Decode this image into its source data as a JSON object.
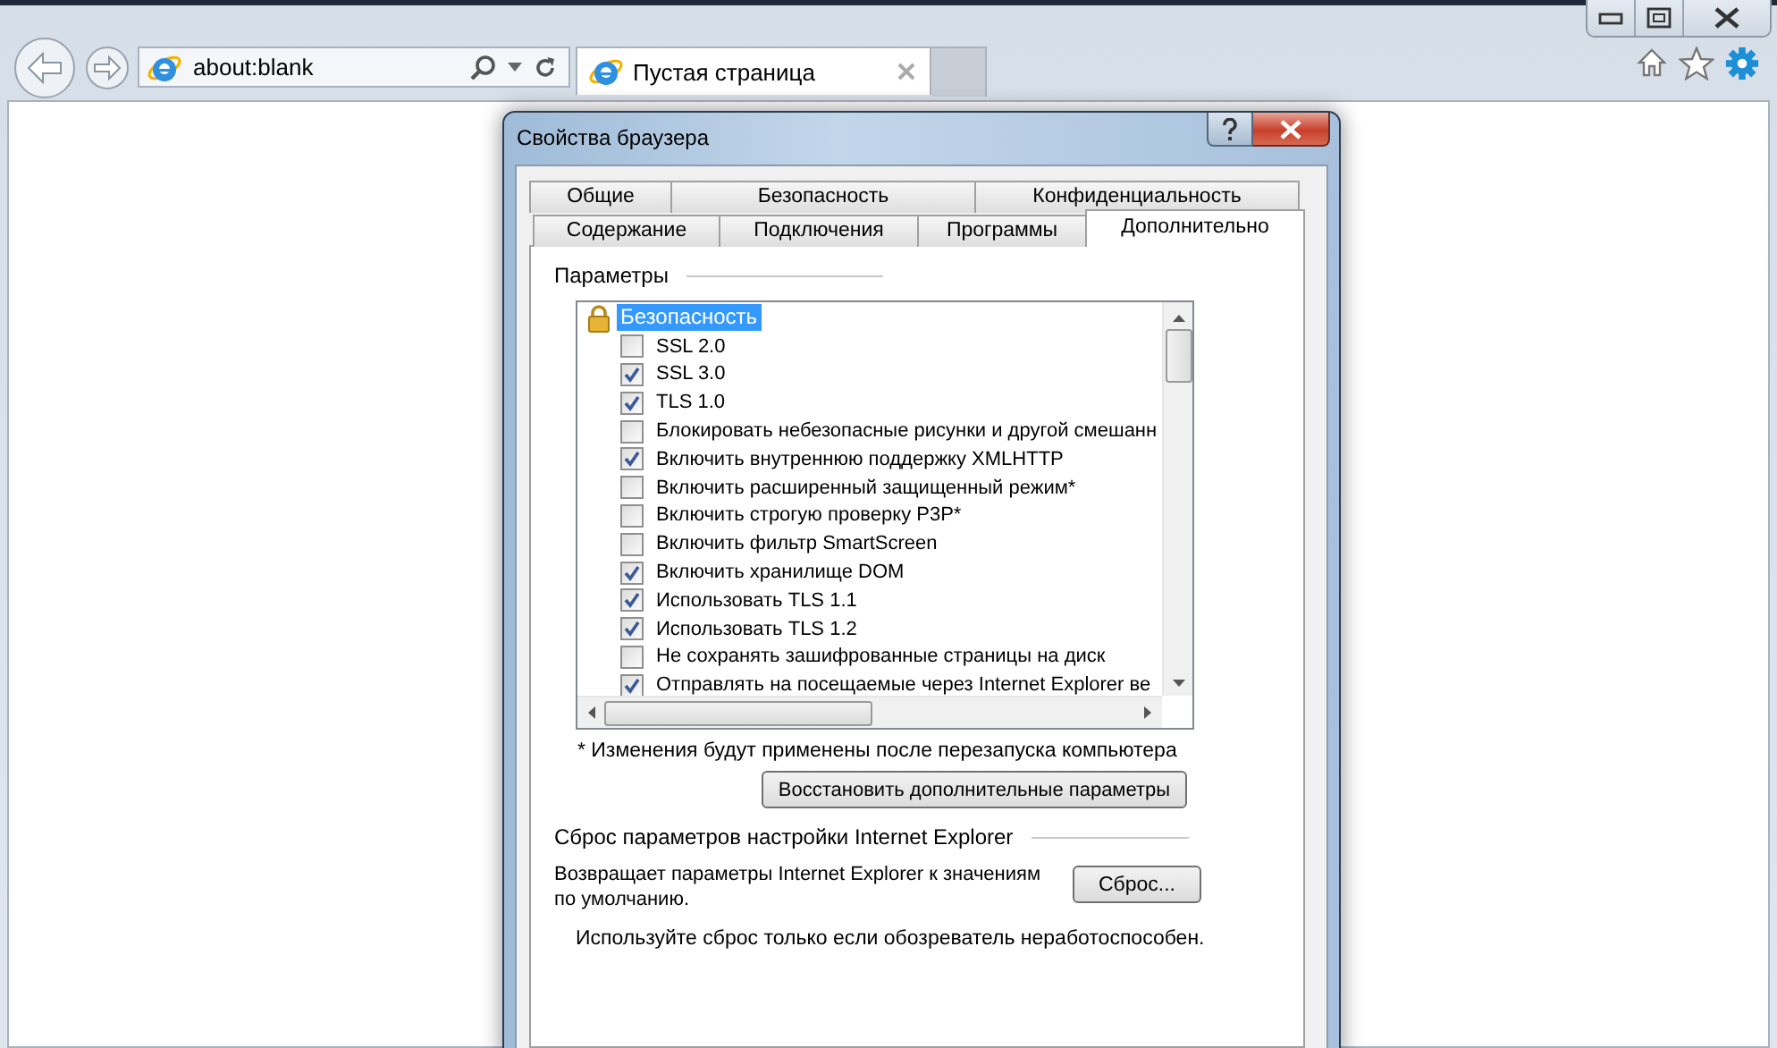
{
  "browser": {
    "address": "about:blank",
    "tab_title": "Пустая страница"
  },
  "dialog": {
    "title": "Свойства браузера",
    "tab_rows": [
      [
        {
          "label": "Общие",
          "selected": false
        },
        {
          "label": "Безопасность",
          "selected": false
        },
        {
          "label": "Конфиденциальность",
          "selected": false
        }
      ],
      [
        {
          "label": "Содержание",
          "selected": false
        },
        {
          "label": "Подключения",
          "selected": false
        },
        {
          "label": "Программы",
          "selected": false
        },
        {
          "label": "Дополнительно",
          "selected": true
        }
      ]
    ],
    "settings_label": "Параметры",
    "tree": {
      "label": "Безопасность",
      "selected": true,
      "children": [
        {
          "label": "SSL 2.0",
          "checked": false
        },
        {
          "label": "SSL 3.0",
          "checked": true
        },
        {
          "label": "TLS 1.0",
          "checked": true
        },
        {
          "label": "Блокировать небезопасные рисунки и другой смешанн",
          "checked": false
        },
        {
          "label": "Включить внутреннюю поддержку XMLHTTP",
          "checked": true
        },
        {
          "label": "Включить расширенный защищенный режим*",
          "checked": false
        },
        {
          "label": "Включить строгую проверку P3P*",
          "checked": false
        },
        {
          "label": "Включить фильтр SmartScreen",
          "checked": false
        },
        {
          "label": "Включить хранилище DOM",
          "checked": true
        },
        {
          "label": "Использовать TLS 1.1",
          "checked": true
        },
        {
          "label": "Использовать TLS 1.2",
          "checked": true
        },
        {
          "label": "Не сохранять зашифрованные страницы на диск",
          "checked": false
        },
        {
          "label": "Отправлять на посещаемые через Internet Explorer ве",
          "checked": true
        }
      ]
    },
    "footnote": "* Изменения будут применены после перезапуска компьютера",
    "restore_button": "Восстановить дополнительные параметры",
    "reset_group": "Сброс параметров настройки Internet Explorer",
    "reset_description": "Возвращает параметры Internet Explorer к значениям по умолчанию.",
    "reset_button": "Сброс...",
    "reset_hint": "Используйте сброс только если обозреватель неработоспособен."
  }
}
